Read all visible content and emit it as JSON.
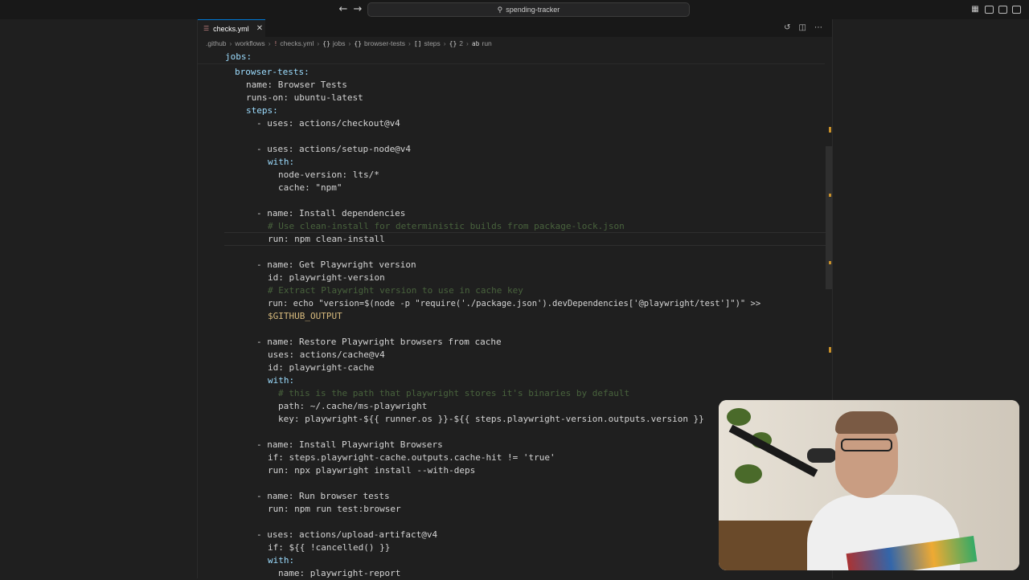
{
  "titlebar": {
    "back_icon": "arrow-left-icon",
    "forward_icon": "arrow-right-icon",
    "search_label": "spending-tracker"
  },
  "tab": {
    "label": "checks.yml"
  },
  "breadcrumb": {
    "items": [
      ".github",
      "workflows",
      "checks.yml",
      "jobs",
      "browser-tests",
      "steps",
      "2",
      "run"
    ]
  },
  "code": {
    "sticky": "jobs:",
    "lines": [
      "browser-tests:",
      "name: Browser Tests",
      "runs-on: ubuntu-latest",
      "steps:",
      "- uses: actions/checkout@v4",
      "- uses: actions/setup-node@v4",
      "with:",
      "node-version: lts/*",
      "cache: \"npm\"",
      "- name: Install dependencies",
      "# Use clean-install for deterministic builds from package-lock.json",
      "run: npm clean-install",
      "- name: Get Playwright version",
      "id: playwright-version",
      "# Extract Playwright version to use in cache key",
      "run: echo \"version=$(node -p \"require('./package.json').devDependencies['@playwright/test']\")\" >>",
      "$GITHUB_OUTPUT",
      "- name: Restore Playwright browsers from cache",
      "uses: actions/cache@v4",
      "id: playwright-cache",
      "with:",
      "# this is the path that playwright stores it's binaries by default",
      "path: ~/.cache/ms-playwright",
      "key: playwright-${{ runner.os }}-${{ steps.playwright-version.outputs.version }}",
      "- name: Install Playwright Browsers",
      "if: steps.playwright-cache.outputs.cache-hit != 'true'",
      "run: npx playwright install --with-deps",
      "- name: Run browser tests",
      "run: npm run test:browser",
      "- uses: actions/upload-artifact@v4",
      "if: ${{ !cancelled() }}",
      "with:",
      "name: playwright-report"
    ]
  },
  "colors": {
    "background": "#1f1f1f",
    "key": "#9cdcfe",
    "string": "#ce9178",
    "comment": "#6a9955",
    "accent": "#0078d4",
    "scroll_marker": "#c8902a"
  }
}
